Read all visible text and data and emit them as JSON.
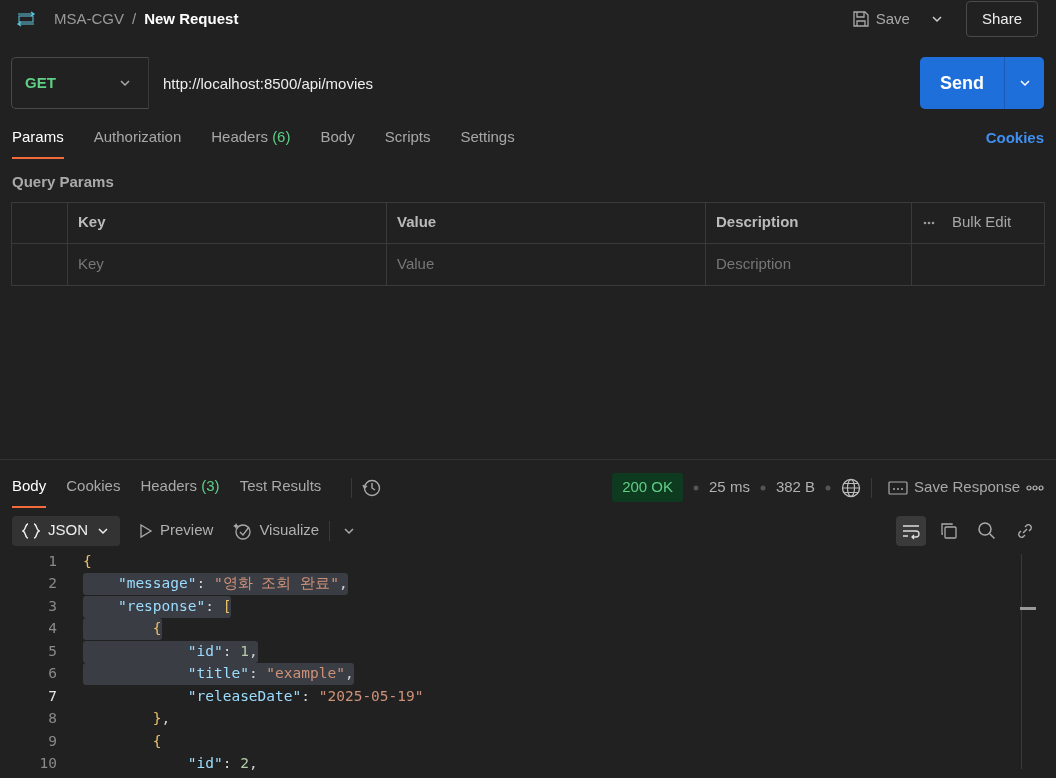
{
  "header": {
    "collection": "MSA-CGV",
    "separator": "/",
    "request_name": "New Request",
    "save": "Save",
    "share": "Share"
  },
  "request": {
    "method": "GET",
    "url": "http://localhost:8500/api/movies",
    "send": "Send"
  },
  "request_tabs": [
    {
      "label": "Params",
      "selected": true
    },
    {
      "label": "Authorization",
      "selected": false
    },
    {
      "label": "Headers",
      "count": "(6)",
      "selected": false
    },
    {
      "label": "Body",
      "selected": false
    },
    {
      "label": "Scripts",
      "selected": false
    },
    {
      "label": "Settings",
      "selected": false
    }
  ],
  "cookies_link": "Cookies",
  "query_params": {
    "title": "Query Params",
    "columns": [
      "Key",
      "Value",
      "Description"
    ],
    "bulk_edit": "Bulk Edit",
    "placeholders": [
      "Key",
      "Value",
      "Description"
    ]
  },
  "response_tabs": [
    {
      "label": "Body",
      "selected": true
    },
    {
      "label": "Cookies",
      "selected": false
    },
    {
      "label": "Headers",
      "count": "(3)",
      "selected": false
    },
    {
      "label": "Test Results",
      "selected": false
    }
  ],
  "response_meta": {
    "status": "200 OK",
    "time": "25 ms",
    "size": "382 B",
    "save_response": "Save Response"
  },
  "view_options": {
    "format": "JSON",
    "preview": "Preview",
    "visualize": "Visualize",
    "wrap_on": true
  },
  "code_lines": [
    {
      "number": "1",
      "selected": false,
      "current": false,
      "tokens": [
        {
          "kind": "brace",
          "text": "{"
        }
      ]
    },
    {
      "number": "2",
      "selected": true,
      "current": false,
      "tokens": [
        {
          "kind": "key",
          "text": "\"message\""
        },
        {
          "kind": "punct",
          "text": ": "
        },
        {
          "kind": "string",
          "text": "\"영화 조회 완료\""
        },
        {
          "kind": "punct",
          "text": ","
        }
      ]
    },
    {
      "number": "3",
      "selected": true,
      "current": false,
      "tokens": [
        {
          "kind": "key",
          "text": "\"response\""
        },
        {
          "kind": "punct",
          "text": ": "
        },
        {
          "kind": "brace",
          "text": "["
        }
      ]
    },
    {
      "number": "4",
      "selected": true,
      "current": false,
      "tokens": [
        {
          "kind": "brace",
          "text": "{"
        }
      ]
    },
    {
      "number": "5",
      "selected": true,
      "current": false,
      "tokens": [
        {
          "kind": "key",
          "text": "\"id\""
        },
        {
          "kind": "punct",
          "text": ": "
        },
        {
          "kind": "number",
          "text": "1"
        },
        {
          "kind": "punct",
          "text": ","
        }
      ]
    },
    {
      "number": "6",
      "selected": true,
      "current": false,
      "tokens": [
        {
          "kind": "key",
          "text": "\"title\""
        },
        {
          "kind": "punct",
          "text": ": "
        },
        {
          "kind": "string",
          "text": "\"example\""
        },
        {
          "kind": "punct",
          "text": ","
        }
      ]
    },
    {
      "number": "7",
      "selected": false,
      "current": true,
      "tokens": [
        {
          "kind": "key",
          "text": "\"releaseDate\""
        },
        {
          "kind": "punct",
          "text": ": "
        },
        {
          "kind": "string",
          "text": "\"2025-05-19\""
        }
      ]
    },
    {
      "number": "8",
      "selected": false,
      "current": false,
      "tokens": [
        {
          "kind": "brace",
          "text": "}"
        },
        {
          "kind": "punct",
          "text": ","
        }
      ]
    },
    {
      "number": "9",
      "selected": false,
      "current": false,
      "tokens": [
        {
          "kind": "brace",
          "text": "{"
        }
      ]
    },
    {
      "number": "10",
      "selected": false,
      "current": false,
      "tokens": [
        {
          "kind": "key",
          "text": "\"id\""
        },
        {
          "kind": "punct",
          "text": ": "
        },
        {
          "kind": "number",
          "text": "2"
        },
        {
          "kind": "punct",
          "text": ","
        }
      ]
    }
  ]
}
